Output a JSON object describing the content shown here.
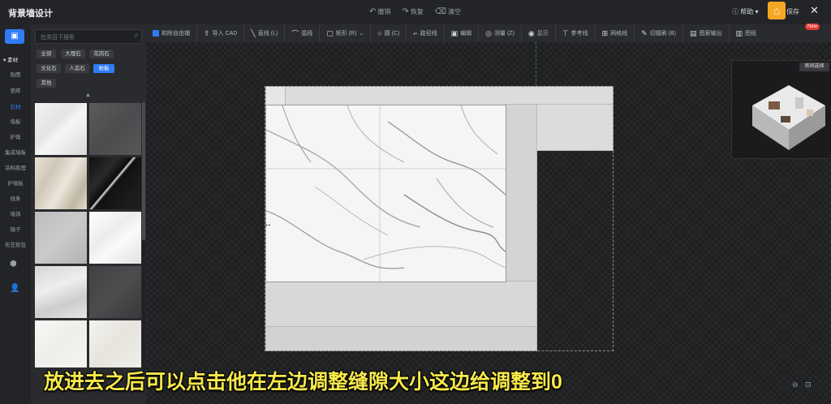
{
  "app": {
    "title": "背景墙设计",
    "actions": [
      {
        "icon": "undo-icon",
        "label": "撤销"
      },
      {
        "icon": "redo-icon",
        "label": "恢复"
      },
      {
        "icon": "eraser-icon",
        "label": "清空"
      }
    ],
    "help_label": "帮助",
    "save_label": "保存"
  },
  "toolbar": {
    "items": [
      "和附自由铺",
      "导入 CAD",
      "直线 (L)",
      "弧线",
      "矩形 (R)",
      "圆 (C)",
      "路径线",
      "编辑",
      "测量 (Z)",
      "显示",
      "参考线",
      "网格线",
      "切缝刷 (B)",
      "图案输出",
      "图纸"
    ],
    "new_badge": "New"
  },
  "rail": {
    "head": "▾ 素材",
    "items": [
      "贴图",
      "瓷砖",
      "石材",
      "墙板",
      "护角",
      "集成墙板",
      "涂料肌理",
      "护墙板",
      "线条",
      "墙饰",
      "镜子",
      "布艺软包"
    ],
    "active_index": 2
  },
  "panel": {
    "search_placeholder": "在类目下搜索",
    "chips": [
      "全部",
      "大理石",
      "花岗石",
      "文化石",
      "人造石",
      "岩板",
      "其他"
    ],
    "active_chip": 5
  },
  "minimap": {
    "button_label": "房间选择"
  },
  "subtitle": "放进去之后可以点击他在左边调整缝隙大小这边给调整到0"
}
